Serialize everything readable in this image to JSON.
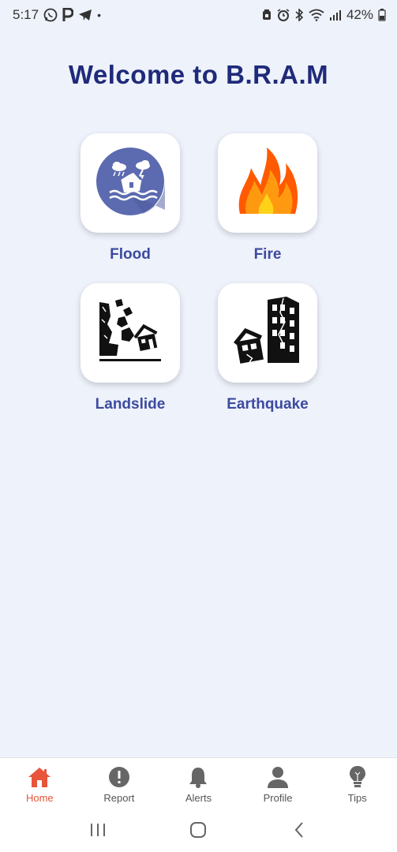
{
  "status_bar": {
    "time": "5:17",
    "left_icons": [
      "whatsapp-icon",
      "p-icon",
      "telegram-icon"
    ],
    "dot": "•",
    "right_icons": [
      "alarm-icon",
      "clock-icon",
      "bluetooth-icon",
      "wifi-icon",
      "signal-icon"
    ],
    "battery": "42%"
  },
  "page": {
    "title": "Welcome to B.R.A.M"
  },
  "disasters": [
    {
      "label": "Flood",
      "icon": "flood-icon"
    },
    {
      "label": "Fire",
      "icon": "fire-icon"
    },
    {
      "label": "Landslide",
      "icon": "landslide-icon"
    },
    {
      "label": "Earthquake",
      "icon": "earthquake-icon"
    }
  ],
  "bottom_nav": {
    "items": [
      {
        "label": "Home",
        "icon": "home-icon",
        "active": true
      },
      {
        "label": "Report",
        "icon": "report-icon",
        "active": false
      },
      {
        "label": "Alerts",
        "icon": "bell-icon",
        "active": false
      },
      {
        "label": "Profile",
        "icon": "person-icon",
        "active": false
      },
      {
        "label": "Tips",
        "icon": "lightbulb-icon",
        "active": false
      }
    ]
  },
  "colors": {
    "background": "#eef2fb",
    "title": "#1f2a7a",
    "label": "#3c4a9e",
    "active_nav": "#e8553b",
    "flood_circle": "#5c6bb0",
    "fire_outer": "#ff6a00",
    "fire_inner": "#ffd21a"
  }
}
